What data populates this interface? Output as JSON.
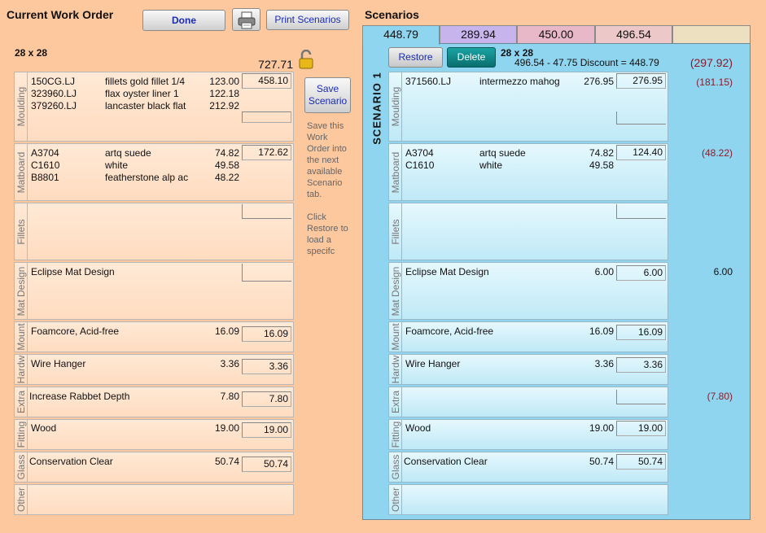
{
  "left": {
    "title": "Current Work Order",
    "done_label": "Done",
    "print_icon": "printer-icon",
    "print_label": "Print Scenarios",
    "size": "28 x 28",
    "total": "727.71",
    "lock_icon": "unlocked-padlock-icon",
    "save_label": "Save Scenario",
    "help1": "Save this Work Order into the next available Scenario tab.",
    "help2": "Click Restore to load a specifc",
    "sections": {
      "moulding": {
        "label": "Moulding",
        "rows": [
          {
            "code": "150CG.LJ",
            "desc": "fillets gold fillet 1/4",
            "price": "123.00"
          },
          {
            "code": "323960.LJ",
            "desc": "flax oyster liner 1",
            "price": "122.18"
          },
          {
            "code": "379260.LJ",
            "desc": "lancaster black flat",
            "price": "212.92"
          }
        ],
        "total": "458.10"
      },
      "matboard": {
        "label": "Matboard",
        "rows": [
          {
            "code": "A3704",
            "desc": "artq suede",
            "price": "74.82"
          },
          {
            "code": "C1610",
            "desc": "white",
            "price": "49.58"
          },
          {
            "code": "B8801",
            "desc": "featherstone alp ac",
            "price": "48.22"
          }
        ],
        "total": "172.62"
      },
      "fillets": {
        "label": "Fillets"
      },
      "matdesign": {
        "label": "Mat Design",
        "name": "Eclipse Mat Design"
      },
      "mount": {
        "label": "Mount",
        "name": "Foamcore, Acid-free",
        "price": "16.09",
        "total": "16.09"
      },
      "hardware": {
        "label": "Hardw",
        "name": "Wire Hanger",
        "price": "3.36",
        "total": "3.36"
      },
      "extra": {
        "label": "Extra",
        "name": "Increase Rabbet Depth",
        "price": "7.80",
        "total": "7.80"
      },
      "fitting": {
        "label": "Fitting",
        "name": "Wood",
        "price": "19.00",
        "total": "19.00"
      },
      "glass": {
        "label": "Glass",
        "name": "Conservation Clear",
        "price": "50.74",
        "total": "50.74"
      },
      "other": {
        "label": "Other"
      }
    }
  },
  "right": {
    "title": "Scenarios",
    "tabs": [
      "448.79",
      "289.94",
      "450.00",
      "496.54",
      ""
    ],
    "tab_colors": [
      "#8fd5f0",
      "#c8b4ec",
      "#e8b8c8",
      "#ecc8c8",
      "#ece0c0"
    ],
    "restore_label": "Restore",
    "delete_label": "Delete",
    "size": "28 x 28",
    "calc": "496.54 - 47.75 Discount = 448.79",
    "total_diff": "(297.92)",
    "scenario_label": "SCENARIO 1",
    "sections": {
      "moulding": {
        "label": "Moulding",
        "rows": [
          {
            "code": "371560.LJ",
            "desc": "intermezzo mahog",
            "price": "276.95"
          }
        ],
        "total": "276.95",
        "diff": "(181.15)"
      },
      "matboard": {
        "label": "Matboard",
        "rows": [
          {
            "code": "A3704",
            "desc": "artq suede",
            "price": "74.82"
          },
          {
            "code": "C1610",
            "desc": "white",
            "price": "49.58"
          }
        ],
        "total": "124.40",
        "diff": "(48.22)"
      },
      "fillets": {
        "label": "Fillets"
      },
      "matdesign": {
        "label": "Mat Design",
        "name": "Eclipse Mat Design",
        "price": "6.00",
        "total": "6.00",
        "diff": "6.00"
      },
      "mount": {
        "label": "Mount",
        "name": "Foamcore, Acid-free",
        "price": "16.09",
        "total": "16.09"
      },
      "hardware": {
        "label": "Hardw",
        "name": "Wire Hanger",
        "price": "3.36",
        "total": "3.36"
      },
      "extra": {
        "label": "Extra",
        "diff": "(7.80)"
      },
      "fitting": {
        "label": "Fitting",
        "name": "Wood",
        "price": "19.00",
        "total": "19.00"
      },
      "glass": {
        "label": "Glass",
        "name": "Conservation Clear",
        "price": "50.74",
        "total": "50.74"
      },
      "other": {
        "label": "Other"
      }
    }
  }
}
